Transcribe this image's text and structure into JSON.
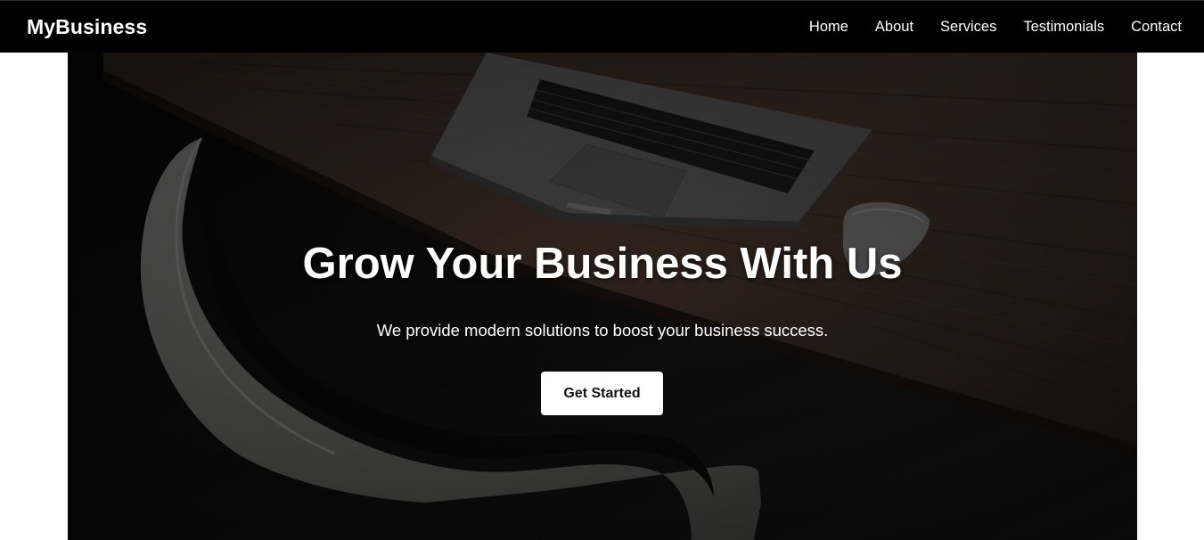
{
  "navbar": {
    "brand": "MyBusiness",
    "links": [
      {
        "label": "Home"
      },
      {
        "label": "About"
      },
      {
        "label": "Services"
      },
      {
        "label": "Testimonials"
      },
      {
        "label": "Contact"
      }
    ]
  },
  "hero": {
    "title": "Grow Your Business With Us",
    "subtitle": "We provide modern solutions to boost your business success.",
    "cta_label": "Get Started",
    "background_image": "laptop-on-wooden-desk-with-chair-photo"
  },
  "colors": {
    "navbar_bg": "#000000",
    "nav_text": "#ffffff",
    "button_bg": "#ffffff",
    "button_text": "#111111",
    "page_bg": "#ffffff"
  }
}
